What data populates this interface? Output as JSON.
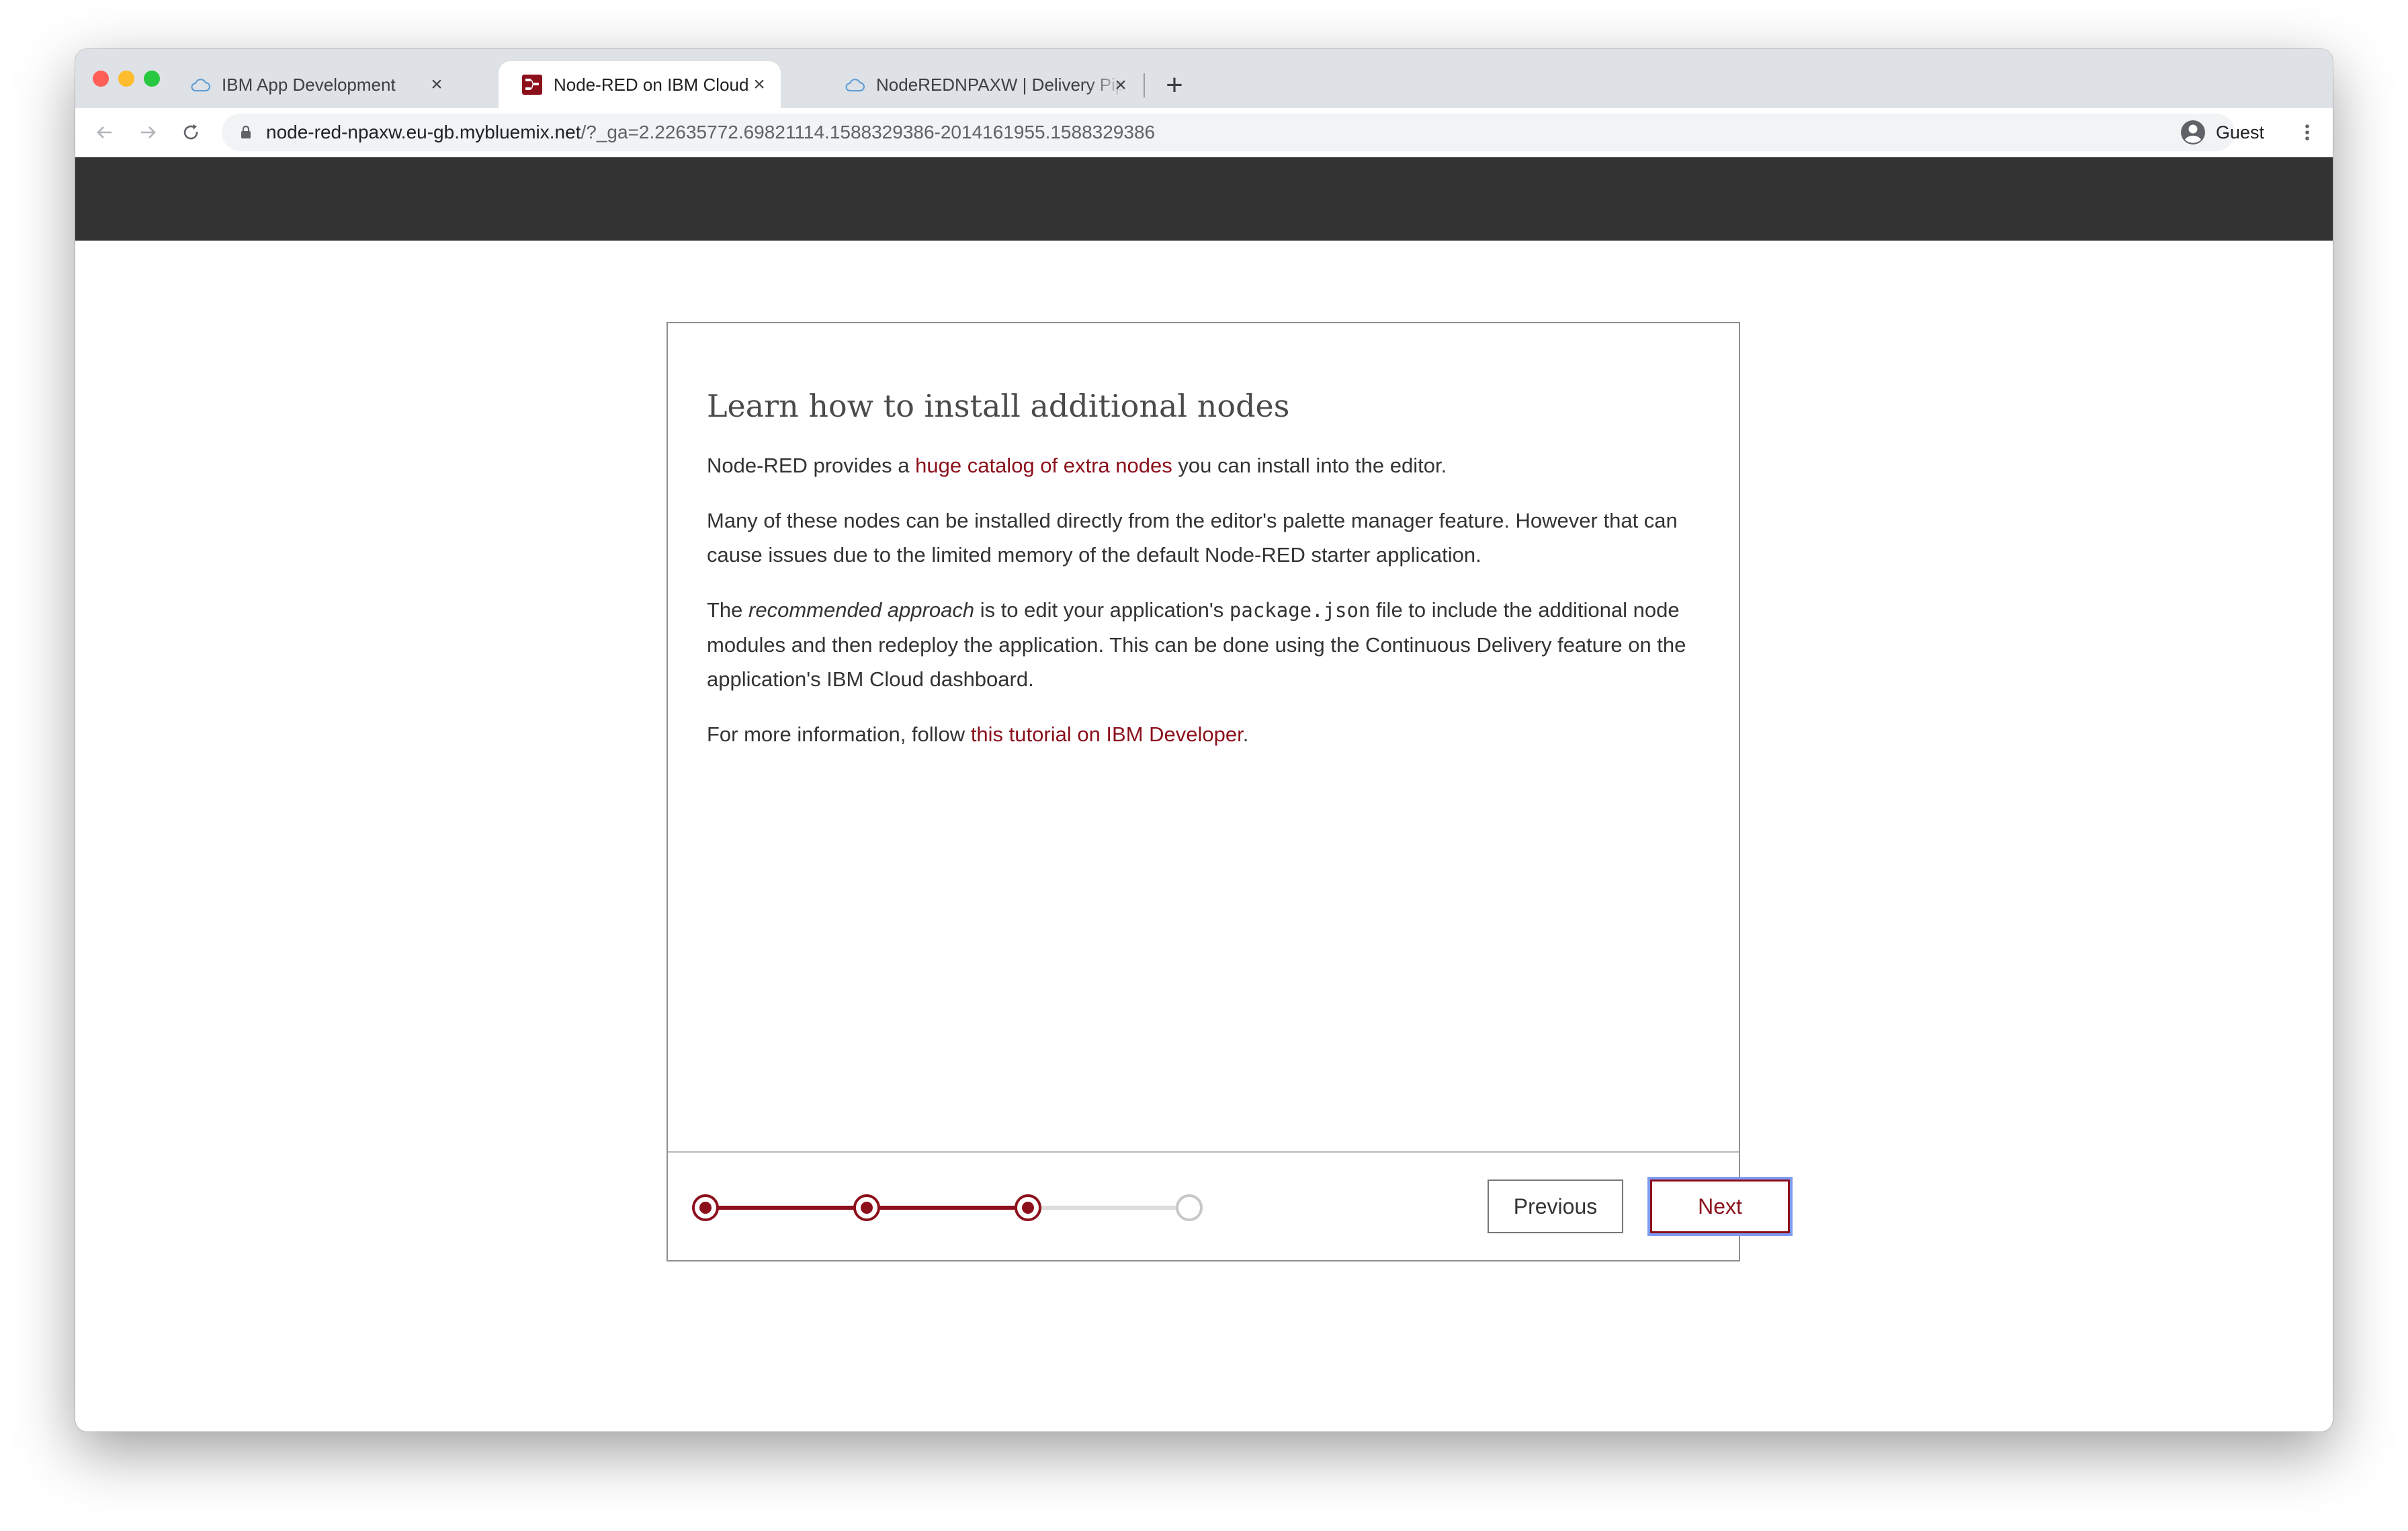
{
  "browser": {
    "tabs": [
      {
        "title": "IBM App Development",
        "favicon": "cloud-icon",
        "active": false
      },
      {
        "title": "Node-RED on IBM Cloud",
        "favicon": "node-red-icon",
        "active": true
      },
      {
        "title": "NodeREDNPAXW | Delivery Pip",
        "favicon": "cloud-icon",
        "active": false
      }
    ],
    "url_host": "node-red-npaxw.eu-gb.mybluemix.net",
    "url_path": "/?_ga=2.22635772.69821114.1588329386-2014161955.1588329386",
    "profile_name": "Guest"
  },
  "dialog": {
    "title": "Learn how to install additional nodes",
    "p1_before": "Node-RED provides a ",
    "p1_link": "huge catalog of extra nodes",
    "p1_after": " you can install into the editor.",
    "p2": "Many of these nodes can be installed directly from the editor's palette manager feature. However that can cause issues due to the limited memory of the default Node-RED starter application.",
    "p3_before": "The ",
    "p3_em": "recommended approach",
    "p3_mid": " is to edit your application's ",
    "p3_code": "package.json",
    "p3_after": " file to include the additional node modules and then redeploy the application. This can be done using the Continuous Delivery feature on the application's IBM Cloud dashboard.",
    "p4_before": "For more information, follow ",
    "p4_link": "this tutorial on IBM Developer",
    "p4_after": ".",
    "previous_label": "Previous",
    "next_label": "Next",
    "steps_total": 4,
    "steps_completed": 3
  },
  "colors": {
    "accent": "#8c101c",
    "header_bar": "#333333",
    "focus_ring": "#7f9cf5"
  }
}
